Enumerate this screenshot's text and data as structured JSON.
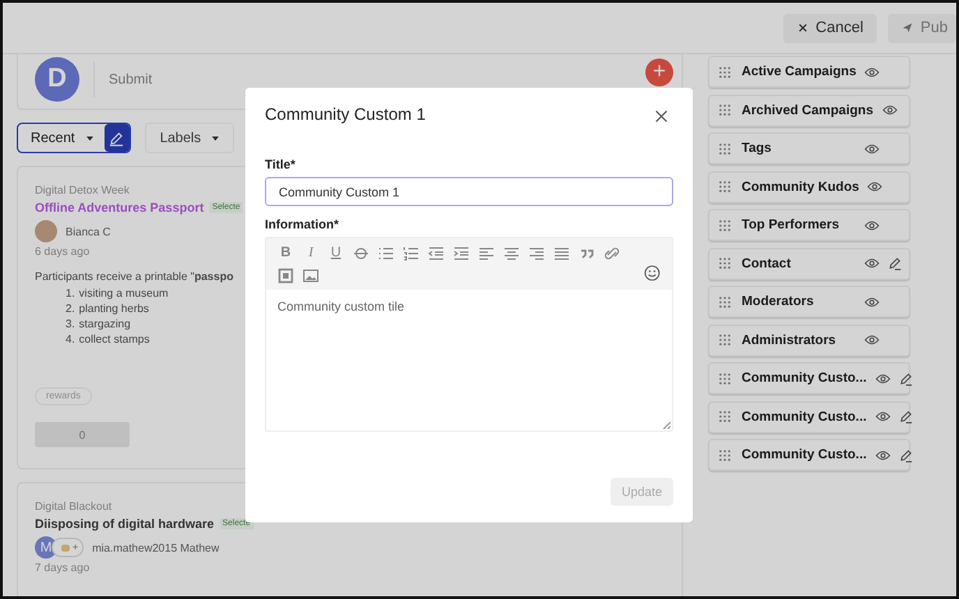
{
  "header": {
    "buttons": [
      {
        "label": "Cancel",
        "kind": "cancel"
      },
      {
        "label": "Pub",
        "kind": "publish"
      }
    ]
  },
  "composer": {
    "avatar_letter": "D",
    "prompt": "Submit"
  },
  "filters": {
    "sort": "Recent",
    "labels": "Labels"
  },
  "posts": [
    {
      "category": "Digital Detox Week",
      "title": "Offline Adventures Passport",
      "color": "#9a4fbf",
      "badge": "Selecte",
      "author": "Bianca C",
      "avatar": {
        "kind": "photo"
      },
      "time": "6 days ago",
      "body": "Participants receive a printable \"**passpo**",
      "list": [
        {
          "marker": "1.",
          "text": "visiting a museum"
        },
        {
          "marker": "2.",
          "text": "planting herbs"
        },
        {
          "marker": "3.",
          "text": "stargazing"
        },
        {
          "marker": "4.",
          "text": "collect stamps"
        }
      ],
      "tags": [
        "rewards"
      ],
      "count": "0"
    },
    {
      "category": "Digital Blackout",
      "title": "Diisposing of digital hardware",
      "color": "#333333",
      "badge": "Selecte",
      "author": "mia.mathew2015 Mathew",
      "avatar": {
        "kind": "letter",
        "letter": "M"
      },
      "extra_avatar": "+",
      "time": "7 days ago"
    }
  ],
  "add_button": "+",
  "sections": [
    {
      "label": "Active Campaigns",
      "editable": false
    },
    {
      "label": "Archived Campaigns",
      "editable": false
    },
    {
      "label": "Tags",
      "editable": false
    },
    {
      "label": "Community Kudos",
      "editable": false
    },
    {
      "label": "Top Performers",
      "editable": false
    },
    {
      "label": "Contact",
      "editable": true
    },
    {
      "label": "Moderators",
      "editable": false
    },
    {
      "label": "Administrators",
      "editable": false
    },
    {
      "label": "Community Custo...",
      "editable": true
    },
    {
      "label": "Community Custo...",
      "editable": true
    },
    {
      "label": "Community Custo...",
      "editable": true
    }
  ],
  "modal": {
    "title": "Community Custom 1",
    "title_label": "Title*",
    "title_value": "Community Custom 1",
    "info_label": "Information*",
    "format_buttons": [
      "B",
      "I",
      "U"
    ],
    "editor_text": "Community custom tile",
    "submit": {
      "label": "Update",
      "disabled": true
    }
  }
}
